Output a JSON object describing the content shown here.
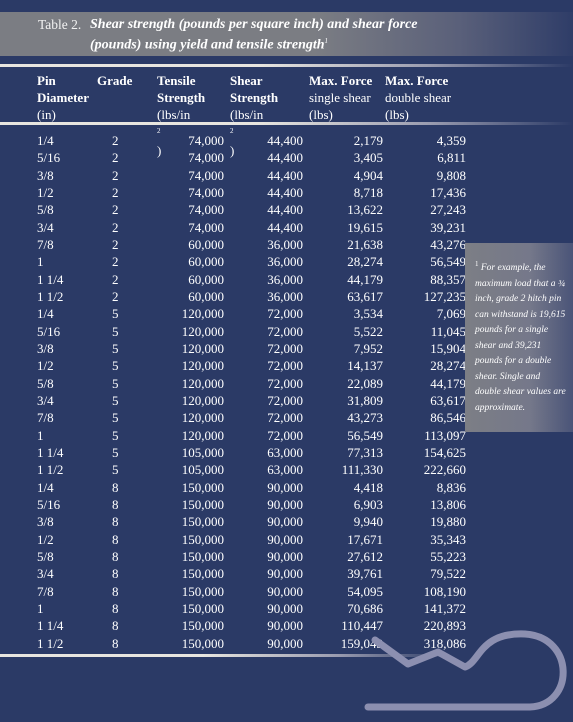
{
  "title": {
    "label": "Table 2.",
    "text": "Shear strength (pounds per square inch) and shear force (pounds) using yield and tensile strength",
    "footnote_ref": "1"
  },
  "columns": [
    {
      "line1": "Pin",
      "line2": "Diameter",
      "line3": "(in)"
    },
    {
      "line1": "Grade",
      "line2": "",
      "line3": ""
    },
    {
      "line1": "Tensile",
      "line2": "Strength",
      "line3": "(lbs/in",
      "sup": "2",
      "line3_end": ")"
    },
    {
      "line1": "Shear",
      "line2": "Strength",
      "line3": "(lbs/in",
      "sup": "2",
      "line3_end": ")"
    },
    {
      "line1": "Max. Force",
      "line2": "single shear",
      "line3": "(lbs)"
    },
    {
      "line1": "Max. Force",
      "line2": "double shear",
      "line3": "(lbs)"
    }
  ],
  "rows": [
    [
      "1/4",
      "2",
      "74,000",
      "44,400",
      "2,179",
      "4,359"
    ],
    [
      "5/16",
      "2",
      "74,000",
      "44,400",
      "3,405",
      "6,811"
    ],
    [
      "3/8",
      "2",
      "74,000",
      "44,400",
      "4,904",
      "9,808"
    ],
    [
      "1/2",
      "2",
      "74,000",
      "44,400",
      "8,718",
      "17,436"
    ],
    [
      "5/8",
      "2",
      "74,000",
      "44,400",
      "13,622",
      "27,243"
    ],
    [
      "3/4",
      "2",
      "74,000",
      "44,400",
      "19,615",
      "39,231"
    ],
    [
      "7/8",
      "2",
      "60,000",
      "36,000",
      "21,638",
      "43,276"
    ],
    [
      "1",
      "2",
      "60,000",
      "36,000",
      "28,274",
      "56,549"
    ],
    [
      "1 1/4",
      "2",
      "60,000",
      "36,000",
      "44,179",
      "88,357"
    ],
    [
      "1 1/2",
      "2",
      "60,000",
      "36,000",
      "63,617",
      "127,235"
    ],
    [
      "1/4",
      "5",
      "120,000",
      "72,000",
      "3,534",
      "7,069"
    ],
    [
      "5/16",
      "5",
      "120,000",
      "72,000",
      "5,522",
      "11,045"
    ],
    [
      "3/8",
      "5",
      "120,000",
      "72,000",
      "7,952",
      "15,904"
    ],
    [
      "1/2",
      "5",
      "120,000",
      "72,000",
      "14,137",
      "28,274"
    ],
    [
      "5/8",
      "5",
      "120,000",
      "72,000",
      "22,089",
      "44,179"
    ],
    [
      "3/4",
      "5",
      "120,000",
      "72,000",
      "31,809",
      "63,617"
    ],
    [
      "7/8",
      "5",
      "120,000",
      "72,000",
      "43,273",
      "86,546"
    ],
    [
      "1",
      "5",
      "120,000",
      "72,000",
      "56,549",
      "113,097"
    ],
    [
      "1 1/4",
      "5",
      "105,000",
      "63,000",
      "77,313",
      "154,625"
    ],
    [
      "1 1/2",
      "5",
      "105,000",
      "63,000",
      "111,330",
      "222,660"
    ],
    [
      "1/4",
      "8",
      "150,000",
      "90,000",
      "4,418",
      "8,836"
    ],
    [
      "5/16",
      "8",
      "150,000",
      "90,000",
      "6,903",
      "13,806"
    ],
    [
      "3/8",
      "8",
      "150,000",
      "90,000",
      "9,940",
      "19,880"
    ],
    [
      "1/2",
      "8",
      "150,000",
      "90,000",
      "17,671",
      "35,343"
    ],
    [
      "5/8",
      "8",
      "150,000",
      "90,000",
      "27,612",
      "55,223"
    ],
    [
      "3/4",
      "8",
      "150,000",
      "90,000",
      "39,761",
      "79,522"
    ],
    [
      "7/8",
      "8",
      "150,000",
      "90,000",
      "54,095",
      "108,190"
    ],
    [
      "1",
      "8",
      "150,000",
      "90,000",
      "70,686",
      "141,372"
    ],
    [
      "1 1/4",
      "8",
      "150,000",
      "90,000",
      "110,447",
      "220,893"
    ],
    [
      "1 1/2",
      "8",
      "150,000",
      "90,000",
      "159,043",
      "318,086"
    ]
  ],
  "footnote": {
    "marker": "1",
    "text": "For example, the maximum load that a ¾ inch, grade 2 hitch pin can withstand is 19,615 pounds for a single shear and 39,231 pounds for a double shear. Single and double shear values are approximate."
  },
  "colors": {
    "background": "#2b3a66",
    "title_band": "#7b7d83",
    "rule": "#e8e6e0",
    "pin_graphic": "#8c8fb0"
  }
}
